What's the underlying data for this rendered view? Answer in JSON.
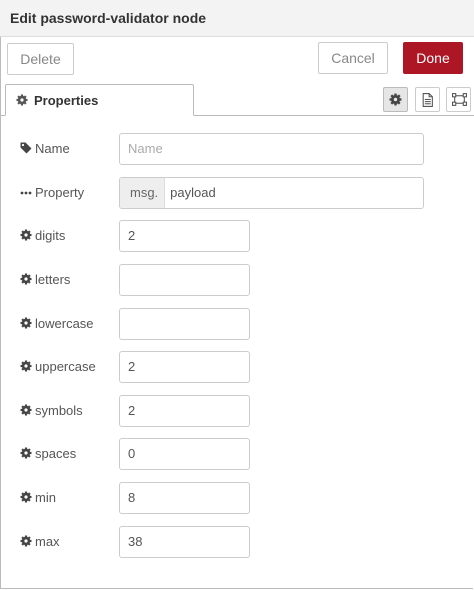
{
  "title": "Edit password-validator node",
  "buttons": {
    "delete": "Delete",
    "cancel": "Cancel",
    "done": "Done"
  },
  "colors": {
    "done_bg": "#ad1625",
    "header_bg": "#f3f3f3"
  },
  "tabs": [
    {
      "label": "Properties",
      "icon": "gear-icon"
    }
  ],
  "toolbar_icons": [
    "gear-icon",
    "document-icon",
    "frame-icon"
  ],
  "form": {
    "name": {
      "label": "Name",
      "icon": "tag-icon",
      "value": "",
      "placeholder": "Name"
    },
    "property": {
      "label": "Property",
      "icon": "ellipsis-icon",
      "prefix": "msg.",
      "value": "payload"
    },
    "digits": {
      "label": "digits",
      "icon": "gear-icon",
      "value": "2"
    },
    "letters": {
      "label": "letters",
      "icon": "gear-icon",
      "value": ""
    },
    "lowercase": {
      "label": "lowercase",
      "icon": "gear-icon",
      "value": ""
    },
    "uppercase": {
      "label": "uppercase",
      "icon": "gear-icon",
      "value": "2"
    },
    "symbols": {
      "label": "symbols",
      "icon": "gear-icon",
      "value": "2"
    },
    "spaces": {
      "label": "spaces",
      "icon": "gear-icon",
      "value": "0"
    },
    "min": {
      "label": "min",
      "icon": "gear-icon",
      "value": "8"
    },
    "max": {
      "label": "max",
      "icon": "gear-icon",
      "value": "38"
    }
  }
}
